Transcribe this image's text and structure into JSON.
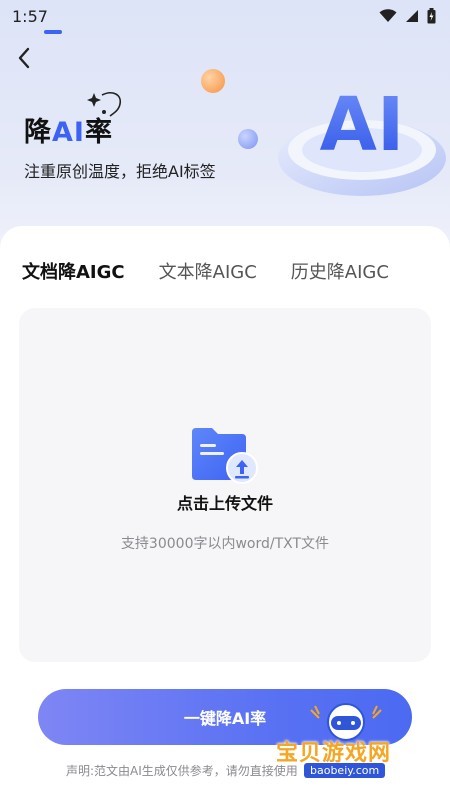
{
  "status_bar": {
    "time": "1:57",
    "icons": [
      "wifi-icon",
      "signal-icon",
      "battery-icon"
    ]
  },
  "nav": {
    "back_icon": "chevron-left-icon"
  },
  "hero": {
    "title_prefix": "降",
    "title_ai": "AI",
    "title_suffix": "率",
    "subtitle": "注重原创温度，拒绝AI标签",
    "art_text": "AI"
  },
  "tabs": [
    {
      "label": "文档降AIGC",
      "active": true
    },
    {
      "label": "文本降AIGC",
      "active": false
    },
    {
      "label": "历史降AIGC",
      "active": false
    }
  ],
  "upload": {
    "icon": "folder-upload-icon",
    "label": "点击上传文件",
    "hint": "支持30000字以内word/TXT文件"
  },
  "primary_button": {
    "label": "一键降AI率"
  },
  "disclaimer": "声明:范文由AI生成仅供参考，请勿直接使用",
  "watermark": {
    "text": "宝贝游戏网",
    "url": "baobeiy.com"
  },
  "colors": {
    "accent": "#3d63f5",
    "button_start": "#7f86f4",
    "button_end": "#4b6af2",
    "upload_bg": "#f6f6f8"
  }
}
